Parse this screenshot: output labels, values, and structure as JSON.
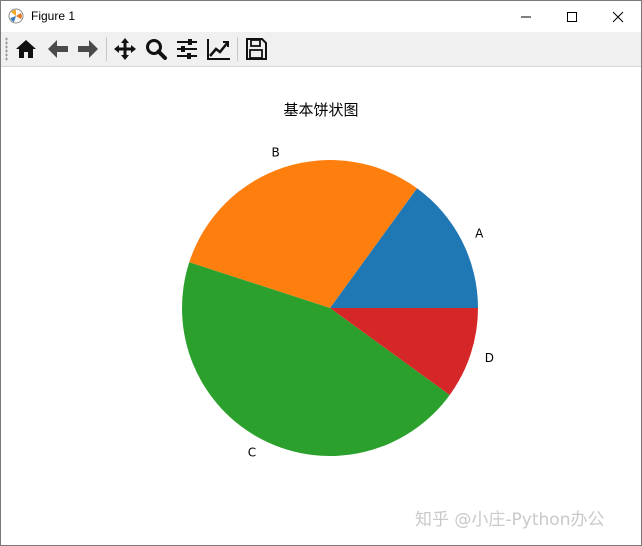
{
  "window": {
    "title": "Figure 1"
  },
  "toolbar": {
    "buttons": [
      {
        "name": "home-button",
        "icon": "home-icon"
      },
      {
        "name": "back-button",
        "icon": "arrow-left-icon"
      },
      {
        "name": "forward-button",
        "icon": "arrow-right-icon"
      },
      {
        "name": "pan-button",
        "icon": "move-icon"
      },
      {
        "name": "zoom-button",
        "icon": "magnifier-icon"
      },
      {
        "name": "configure-subplots-button",
        "icon": "sliders-icon"
      },
      {
        "name": "edit-axis-button",
        "icon": "trend-chart-icon"
      },
      {
        "name": "save-button",
        "icon": "floppy-disk-icon"
      }
    ]
  },
  "chart_data": {
    "type": "pie",
    "title": "基本饼状图",
    "labels": [
      "A",
      "B",
      "C",
      "D"
    ],
    "values": [
      15,
      30,
      45,
      10
    ],
    "colors": [
      "#1f77b4",
      "#ff7f0e",
      "#2ca02c",
      "#d62728"
    ],
    "start_angle_deg": 0,
    "direction": "counterclockwise"
  },
  "watermark": "知乎 @小庄-Python办公"
}
